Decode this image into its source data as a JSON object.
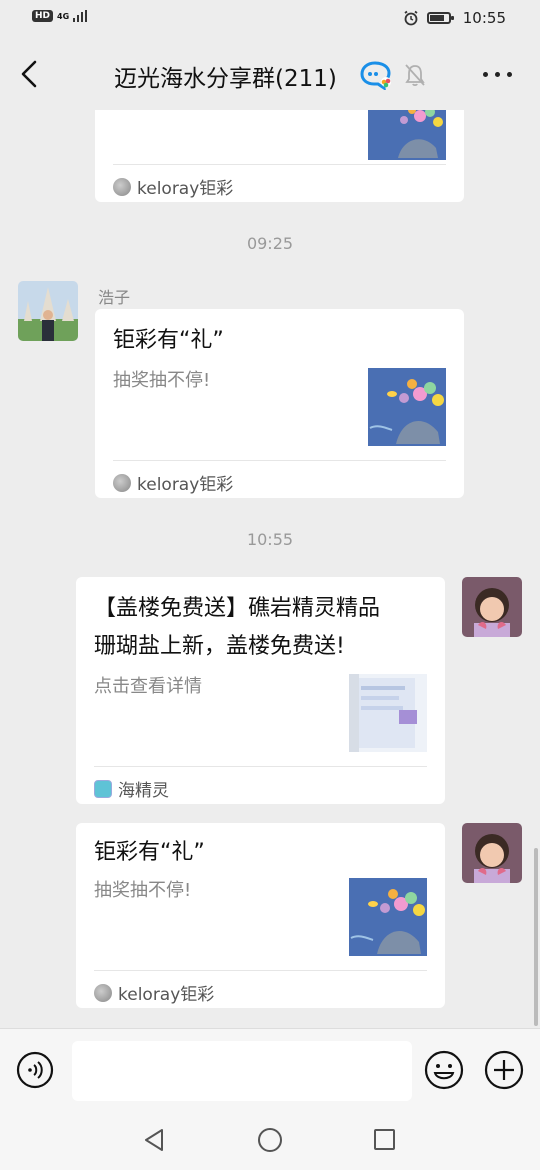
{
  "status_bar": {
    "hd": "HD",
    "network": "4G",
    "time": "10:55"
  },
  "header": {
    "title": "迈光海水分享群(211)"
  },
  "messages": [
    {
      "type": "card-partial",
      "source": "keloray钜彩"
    },
    {
      "type": "time",
      "text": "09:25"
    },
    {
      "type": "card",
      "sender": "浩子",
      "title": "钜彩有“礼”",
      "desc": "抽奖抽不停!",
      "source": "keloray钜彩"
    },
    {
      "type": "time",
      "text": "10:55"
    },
    {
      "type": "card",
      "title_line1": "【盖楼免费送】礁岩精灵精品",
      "title_line2": "珊瑚盐上新，盖楼免费送!",
      "desc": "点击查看详情",
      "source": "海精灵"
    },
    {
      "type": "card",
      "title": "钜彩有“礼”",
      "desc": "抽奖抽不停!",
      "source": "keloray钜彩"
    }
  ],
  "icons": {
    "back": "back-arrow-icon",
    "chat_group": "qq-chat-icon",
    "mute": "bell-muted-icon",
    "more": "more-dots-icon",
    "voice": "voice-icon",
    "emoji": "emoji-icon",
    "plus": "plus-icon",
    "nav_back": "triangle-back-icon",
    "nav_home": "circle-home-icon",
    "nav_recent": "square-recent-icon"
  },
  "colors": {
    "background": "#ededed",
    "card": "#ffffff",
    "accent": "#1aad19"
  }
}
